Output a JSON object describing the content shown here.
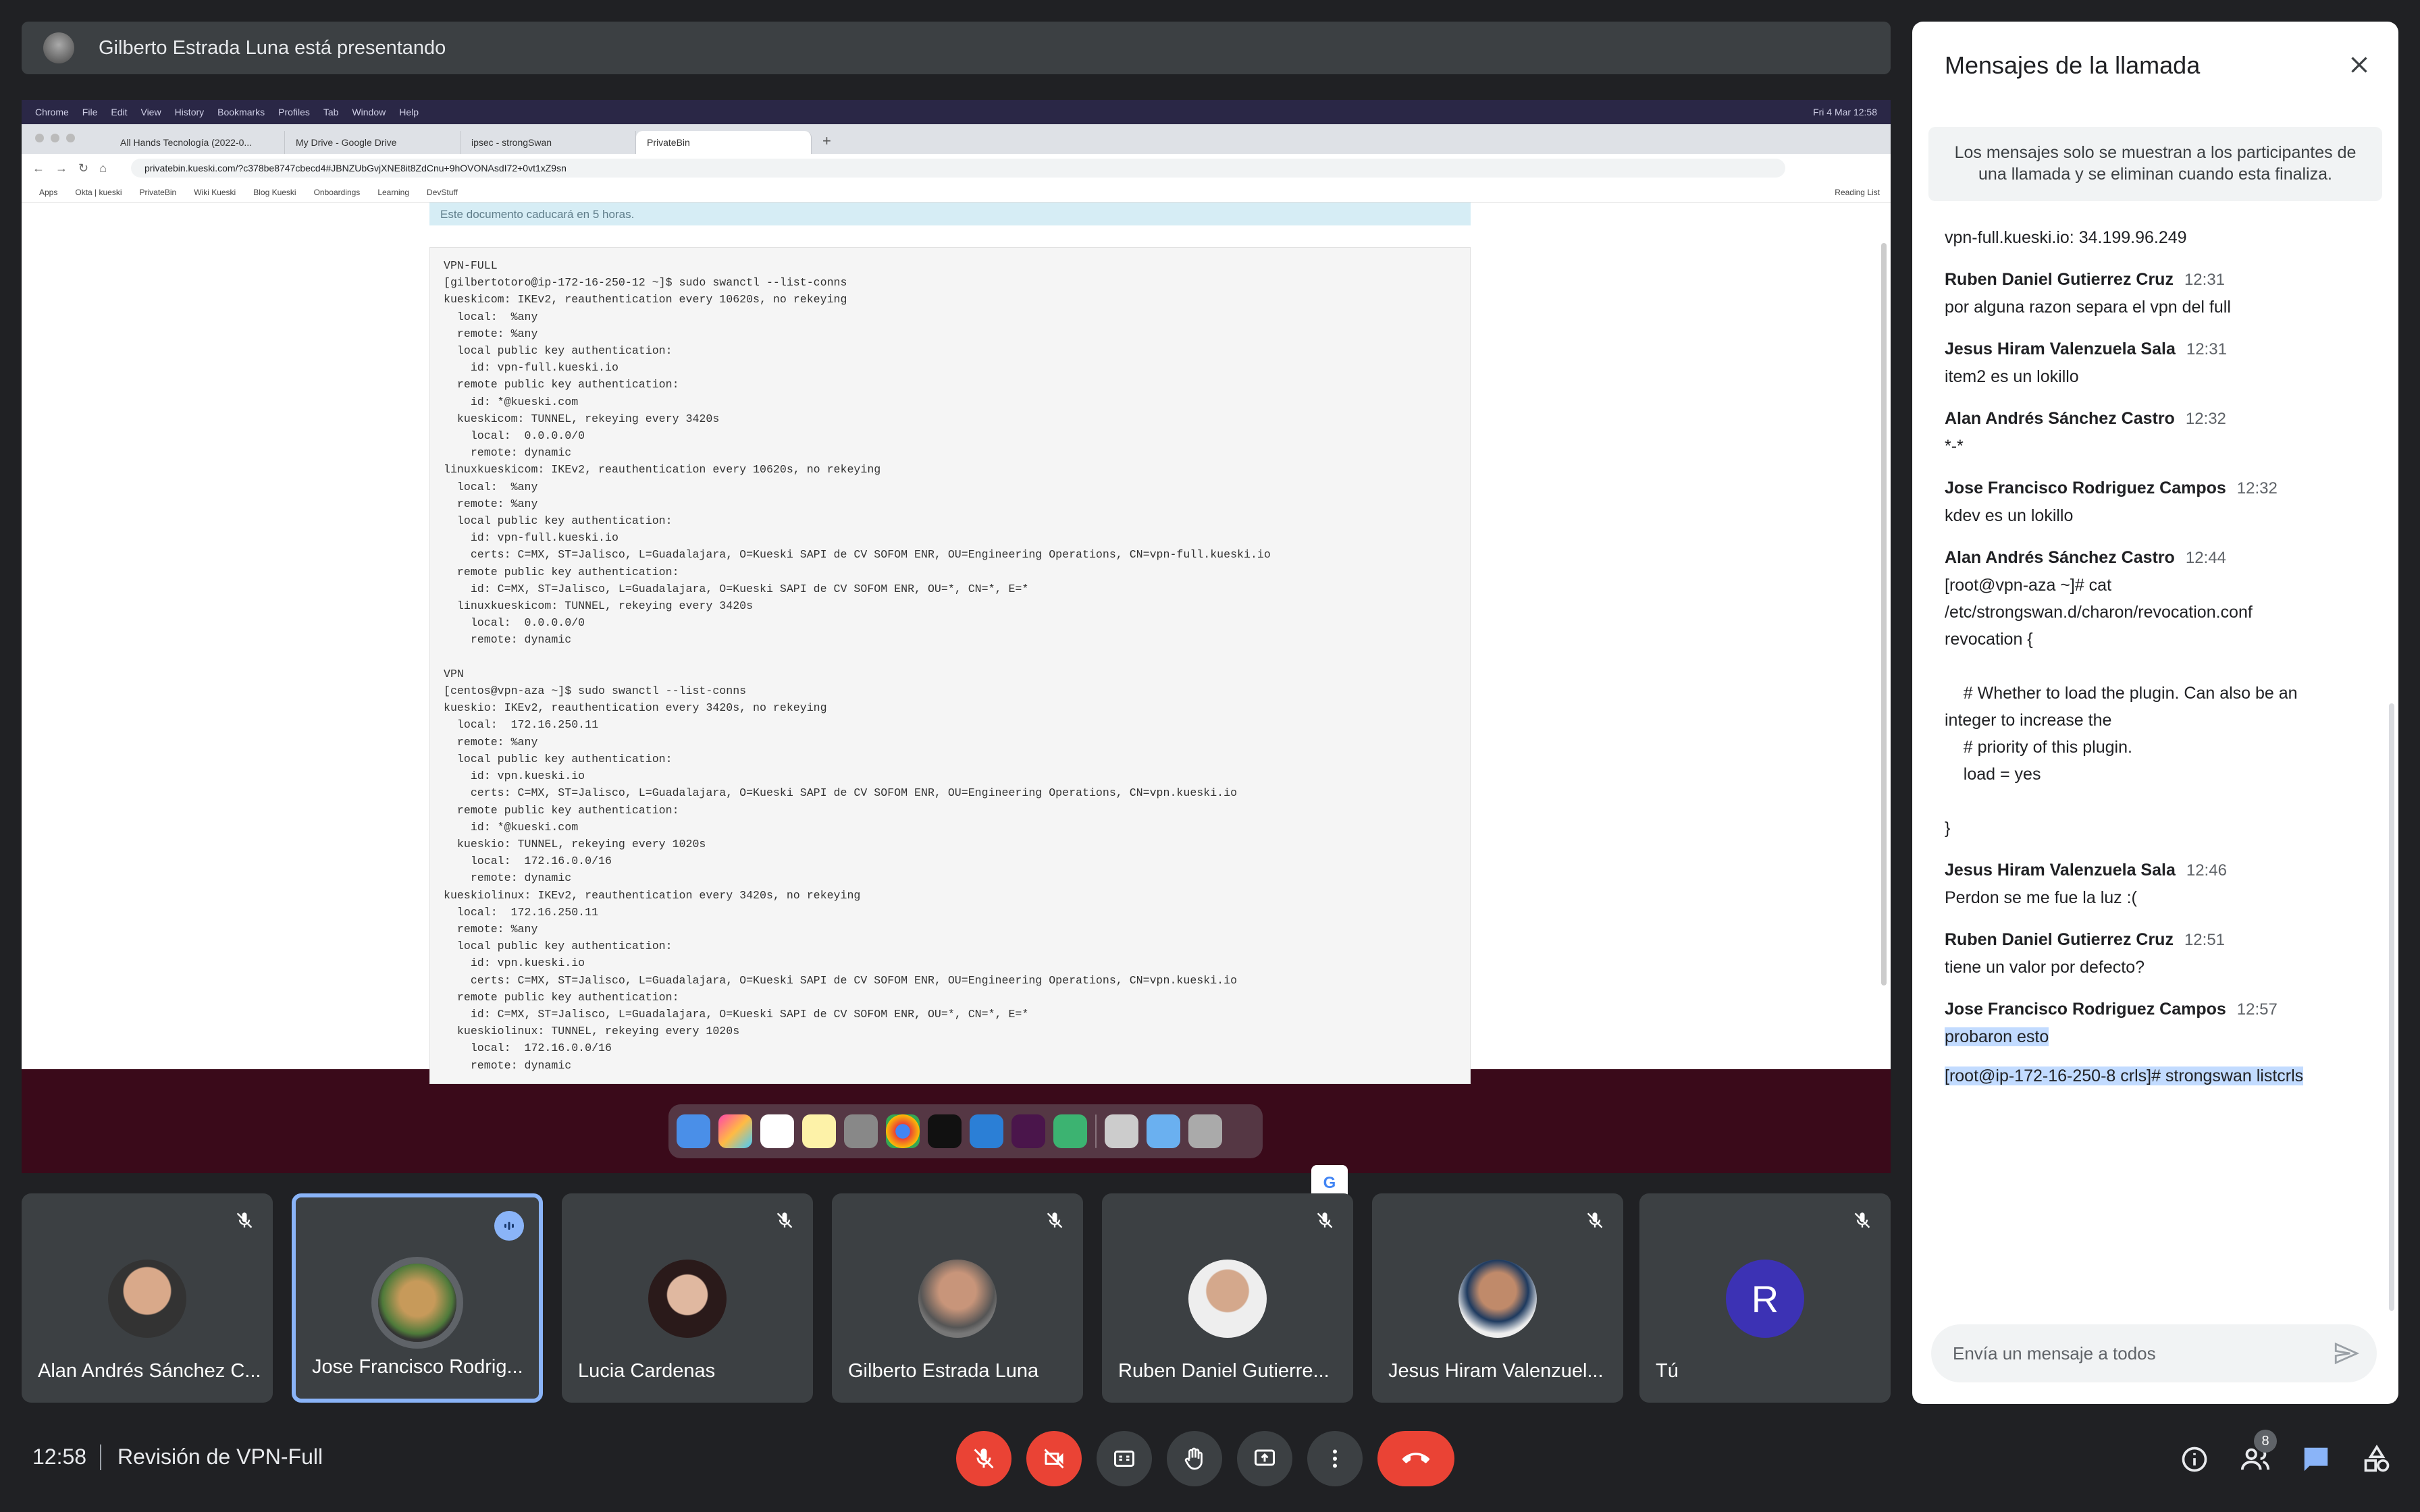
{
  "presenter": {
    "text": "Gilberto Estrada Luna está presentando"
  },
  "shared": {
    "menubar": [
      "Chrome",
      "File",
      "Edit",
      "View",
      "History",
      "Bookmarks",
      "Profiles",
      "Tab",
      "Window",
      "Help"
    ],
    "clock": "Fri 4 Mar 12:58",
    "tabs": [
      "All Hands Tecnología (2022-0...",
      "My Drive - Google Drive",
      "ipsec - strongSwan",
      "PrivateBin"
    ],
    "url": "privatebin.kueski.com/?c378be8747cbecd4#JBNZUbGvjXNE8it8ZdCnu+9hOVONAsdI72+0vt1xZ9sn",
    "bookmarks": [
      "Apps",
      "Okta | kueski",
      "PrivateBin",
      "Wiki Kueski",
      "Blog Kueski",
      "Onboardings",
      "Learning",
      "DevStuff"
    ],
    "reading_list": "Reading List",
    "info": "Este documento caducará en 5 horas.",
    "code_lines": [
      "VPN-FULL",
      "[gilbertotoro@ip-172-16-250-12 ~]$ sudo swanctl --list-conns",
      "kueskicom: IKEv2, reauthentication every 10620s, no rekeying",
      "  local:  %any",
      "  remote: %any",
      "  local public key authentication:",
      "    id: vpn-full.kueski.io",
      "  remote public key authentication:",
      "    id: *@kueski.com",
      "  kueskicom: TUNNEL, rekeying every 3420s",
      "    local:  0.0.0.0/0",
      "    remote: dynamic",
      "linuxkueskicom: IKEv2, reauthentication every 10620s, no rekeying",
      "  local:  %any",
      "  remote: %any",
      "  local public key authentication:",
      "    id: vpn-full.kueski.io",
      "    certs: C=MX, ST=Jalisco, L=Guadalajara, O=Kueski SAPI de CV SOFOM ENR, OU=Engineering Operations, CN=vpn-full.kueski.io",
      "  remote public key authentication:",
      "    id: C=MX, ST=Jalisco, L=Guadalajara, O=Kueski SAPI de CV SOFOM ENR, OU=*, CN=*, E=*",
      "  linuxkueskicom: TUNNEL, rekeying every 3420s",
      "    local:  0.0.0.0/0",
      "    remote: dynamic",
      "",
      "VPN",
      "[centos@vpn-aza ~]$ sudo swanctl --list-conns",
      "kueskio: IKEv2, reauthentication every 3420s, no rekeying",
      "  local:  172.16.250.11",
      "  remote: %any",
      "  local public key authentication:",
      "    id: vpn.kueski.io",
      "    certs: C=MX, ST=Jalisco, L=Guadalajara, O=Kueski SAPI de CV SOFOM ENR, OU=Engineering Operations, CN=vpn.kueski.io",
      "  remote public key authentication:",
      "    id: *@kueski.com",
      "  kueskio: TUNNEL, rekeying every 1020s",
      "    local:  172.16.0.0/16",
      "    remote: dynamic",
      "kueskiolinux: IKEv2, reauthentication every 3420s, no rekeying",
      "  local:  172.16.250.11",
      "  remote: %any",
      "  local public key authentication:",
      "    id: vpn.kueski.io",
      "    certs: C=MX, ST=Jalisco, L=Guadalajara, O=Kueski SAPI de CV SOFOM ENR, OU=Engineering Operations, CN=vpn.kueski.io",
      "  remote public key authentication:",
      "    id: C=MX, ST=Jalisco, L=Guadalajara, O=Kueski SAPI de CV SOFOM ENR, OU=*, CN=*, E=*",
      "  kueskiolinux: TUNNEL, rekeying every 1020s",
      "    local:  172.16.0.0/16",
      "    remote: dynamic"
    ]
  },
  "participants": [
    {
      "name": "Alan Andrés Sánchez C..."
    },
    {
      "name": "Jose Francisco Rodrig..."
    },
    {
      "name": "Lucia Cardenas"
    },
    {
      "name": "Gilberto Estrada Luna"
    },
    {
      "name": "Ruben Daniel Gutierre..."
    },
    {
      "name": "Jesus Hiram Valenzuel..."
    },
    {
      "name": "Tú",
      "initial": "R"
    }
  ],
  "bottom": {
    "time": "12:58",
    "meeting": "Revisión de VPN-Full",
    "people_count": "8"
  },
  "chat": {
    "title": "Mensajes de la llamada",
    "notice": "Los mensajes solo se muestran a los participantes de una llamada y se eliminan cuando esta finaliza.",
    "first_line": "vpn-full.kueski.io: 34.199.96.249",
    "messages": [
      {
        "who": "Ruben Daniel Gutierrez Cruz",
        "ts": "12:31",
        "body": "por alguna razon separa el vpn del full"
      },
      {
        "who": "Jesus Hiram Valenzuela Sala",
        "ts": "12:31",
        "body": "item2 es un lokillo"
      },
      {
        "who": "Alan Andrés Sánchez Castro",
        "ts": "12:32",
        "body": "*-*"
      },
      {
        "who": "Jose Francisco Rodriguez Campos",
        "ts": "12:32",
        "body": "kdev es un lokillo"
      },
      {
        "who": "Alan Andrés Sánchez Castro",
        "ts": "12:44",
        "body": "[root@vpn-aza ~]# cat\n/etc/strongswan.d/charon/revocation.conf\nrevocation {\n\n    # Whether to load the plugin. Can also be an\ninteger to increase the\n    # priority of this plugin.\n    load = yes\n\n}"
      },
      {
        "who": "Jesus Hiram Valenzuela Sala",
        "ts": "12:46",
        "body": "Perdon se me fue la luz :("
      },
      {
        "who": "Ruben Daniel Gutierrez Cruz",
        "ts": "12:51",
        "body": "tiene un valor por defecto?"
      },
      {
        "who": "Jose Francisco Rodriguez Campos",
        "ts": "12:57",
        "body": "probaron esto",
        "body2": "[root@ip-172-16-250-8 crls]# strongswan listcrls"
      }
    ],
    "placeholder": "Envía un mensaje a todos"
  },
  "colors": {
    "accent": "#8ab4f8",
    "end_call": "#ea4335",
    "tile_bg": "#3c4043",
    "panel_bg": "#ffffff"
  },
  "icons": [
    "mic-off-icon",
    "camera-off-icon",
    "captions-icon",
    "raise-hand-icon",
    "present-icon",
    "more-icon",
    "end-call-icon",
    "info-icon",
    "people-icon",
    "chat-icon",
    "activities-icon",
    "close-icon",
    "send-icon"
  ]
}
